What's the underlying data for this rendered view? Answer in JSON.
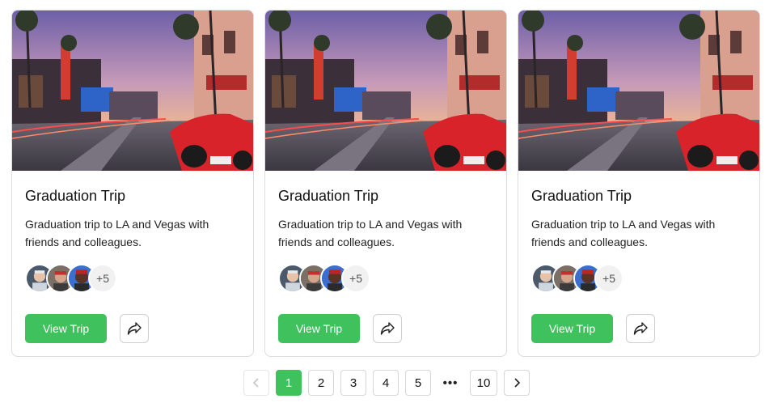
{
  "cards": [
    {
      "title": "Graduation Trip",
      "description": "Graduation trip to LA and Vegas with friends and colleagues.",
      "image_icon": "hollywood-street-photo",
      "extra_members": "+5",
      "view_label": "View Trip",
      "share_icon": "share-icon"
    },
    {
      "title": "Graduation Trip",
      "description": "Graduation trip to LA and Vegas with friends and colleagues.",
      "image_icon": "hollywood-street-photo",
      "extra_members": "+5",
      "view_label": "View Trip",
      "share_icon": "share-icon"
    },
    {
      "title": "Graduation Trip",
      "description": "Graduation trip to LA and Vegas with friends and colleagues.",
      "image_icon": "hollywood-street-photo",
      "extra_members": "+5",
      "view_label": "View Trip",
      "share_icon": "share-icon"
    }
  ],
  "pagination": {
    "prev_icon": "chevron-left-icon",
    "pages": [
      "1",
      "2",
      "3",
      "4",
      "5"
    ],
    "ellipsis": "•••",
    "last_page": "10",
    "current": "1",
    "next_icon": "chevron-right-icon"
  },
  "colors": {
    "accent": "#3fc15d",
    "border": "#dcdcdc"
  }
}
